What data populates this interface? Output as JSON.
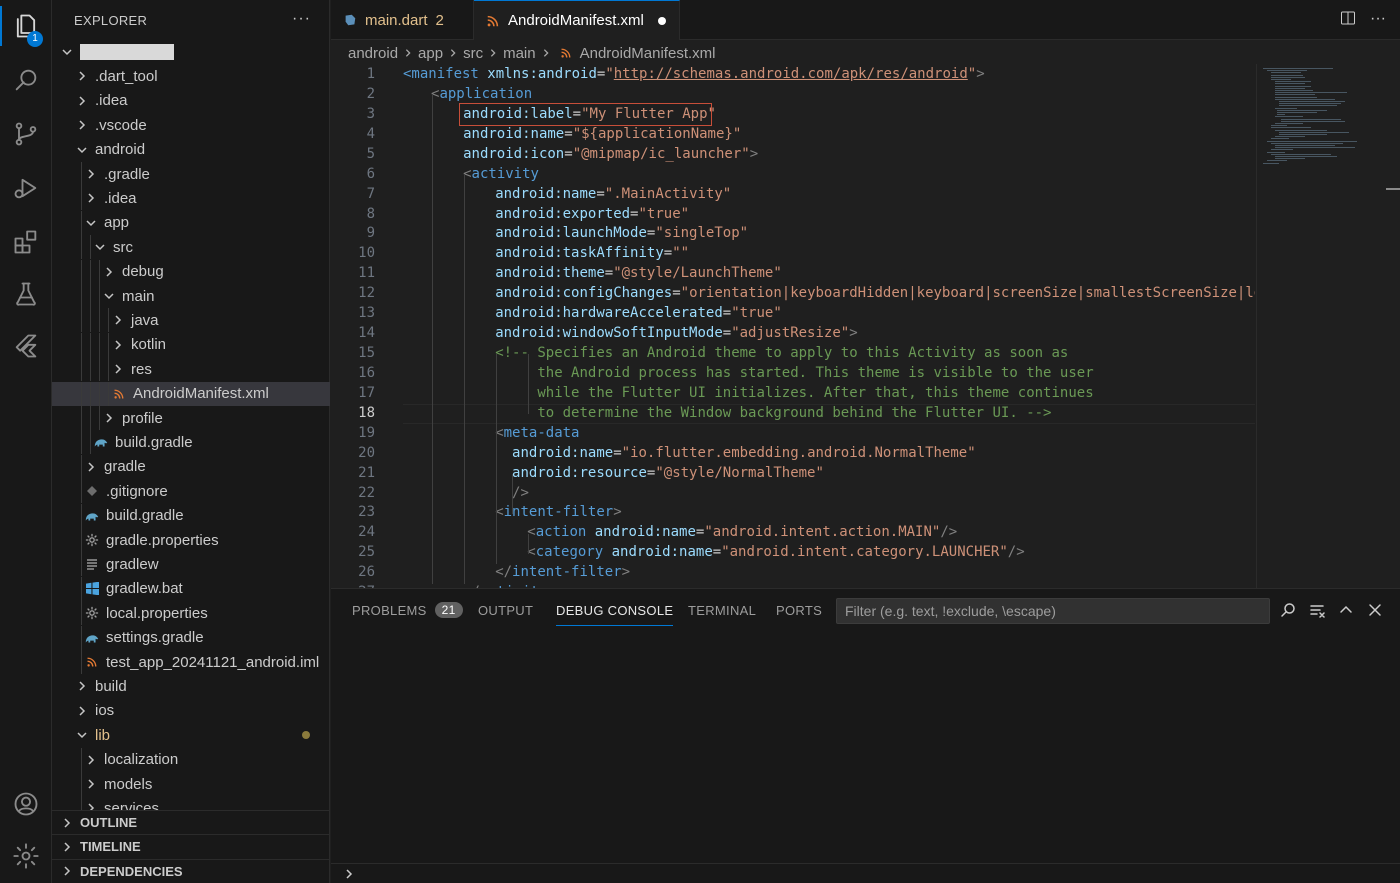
{
  "activity": {
    "explorer_badge": "1"
  },
  "sidebar": {
    "title": "EXPLORER",
    "more": "···",
    "tree": [
      {
        "label": "",
        "depth": 0,
        "kind": "folder-open",
        "redacted": true
      },
      {
        "label": ".dart_tool",
        "depth": 1,
        "kind": "folder"
      },
      {
        "label": ".idea",
        "depth": 1,
        "kind": "folder"
      },
      {
        "label": ".vscode",
        "depth": 1,
        "kind": "folder"
      },
      {
        "label": "android",
        "depth": 1,
        "kind": "folder-open"
      },
      {
        "label": ".gradle",
        "depth": 2,
        "kind": "folder"
      },
      {
        "label": ".idea",
        "depth": 2,
        "kind": "folder"
      },
      {
        "label": "app",
        "depth": 2,
        "kind": "folder-open"
      },
      {
        "label": "src",
        "depth": 3,
        "kind": "folder-open"
      },
      {
        "label": "debug",
        "depth": 4,
        "kind": "folder"
      },
      {
        "label": "main",
        "depth": 4,
        "kind": "folder-open"
      },
      {
        "label": "java",
        "depth": 5,
        "kind": "folder"
      },
      {
        "label": "kotlin",
        "depth": 5,
        "kind": "folder"
      },
      {
        "label": "res",
        "depth": 5,
        "kind": "folder"
      },
      {
        "label": "AndroidManifest.xml",
        "depth": 5,
        "kind": "file",
        "icon": "rss",
        "selected": true
      },
      {
        "label": "profile",
        "depth": 4,
        "kind": "folder"
      },
      {
        "label": "build.gradle",
        "depth": 3,
        "kind": "file",
        "icon": "gradle"
      },
      {
        "label": "gradle",
        "depth": 2,
        "kind": "folder"
      },
      {
        "label": ".gitignore",
        "depth": 2,
        "kind": "file",
        "icon": "git"
      },
      {
        "label": "build.gradle",
        "depth": 2,
        "kind": "file",
        "icon": "gradle"
      },
      {
        "label": "gradle.properties",
        "depth": 2,
        "kind": "file",
        "icon": "gear"
      },
      {
        "label": "gradlew",
        "depth": 2,
        "kind": "file",
        "icon": "lines"
      },
      {
        "label": "gradlew.bat",
        "depth": 2,
        "kind": "file",
        "icon": "windows"
      },
      {
        "label": "local.properties",
        "depth": 2,
        "kind": "file",
        "icon": "gear"
      },
      {
        "label": "settings.gradle",
        "depth": 2,
        "kind": "file",
        "icon": "gradle"
      },
      {
        "label": "test_app_20241121_android.iml",
        "depth": 2,
        "kind": "file",
        "icon": "rss"
      },
      {
        "label": "build",
        "depth": 1,
        "kind": "folder"
      },
      {
        "label": "ios",
        "depth": 1,
        "kind": "folder"
      },
      {
        "label": "lib",
        "depth": 1,
        "kind": "folder-open",
        "modified": true
      },
      {
        "label": "localization",
        "depth": 2,
        "kind": "folder"
      },
      {
        "label": "models",
        "depth": 2,
        "kind": "folder"
      },
      {
        "label": "services",
        "depth": 2,
        "kind": "folder"
      }
    ],
    "sections": [
      "OUTLINE",
      "TIMELINE",
      "DEPENDENCIES"
    ]
  },
  "tabs": [
    {
      "label": "main.dart",
      "suffix": "2",
      "icon": "dart",
      "active": false
    },
    {
      "label": "AndroidManifest.xml",
      "icon": "rss",
      "active": true,
      "dirty": true
    }
  ],
  "breadcrumb": [
    "android",
    "app",
    "src",
    "main",
    "AndroidManifest.xml"
  ],
  "editor": {
    "current_line": 18,
    "lines": [
      {
        "n": 1,
        "i": 0,
        "t": [
          [
            "tag",
            "<manifest"
          ],
          [
            "plain",
            " "
          ],
          [
            "attr",
            "xmlns:android"
          ],
          [
            "plain",
            "="
          ],
          [
            "str",
            "\""
          ],
          [
            "url",
            "http://schemas.android.com/apk/res/android"
          ],
          [
            "str",
            "\""
          ],
          [
            "punct",
            ">"
          ]
        ]
      },
      {
        "n": 2,
        "i": 1,
        "t": [
          [
            "punct",
            "<"
          ],
          [
            "tag",
            "application"
          ]
        ]
      },
      {
        "n": 3,
        "i": 2,
        "t": [
          [
            "attr",
            "android:label"
          ],
          [
            "plain",
            "="
          ],
          [
            "str",
            "\"My Flutter App\""
          ]
        ]
      },
      {
        "n": 4,
        "i": 2,
        "t": [
          [
            "attr",
            "android:name"
          ],
          [
            "plain",
            "="
          ],
          [
            "str",
            "\"${applicationName}\""
          ]
        ]
      },
      {
        "n": 5,
        "i": 2,
        "t": [
          [
            "attr",
            "android:icon"
          ],
          [
            "plain",
            "="
          ],
          [
            "str",
            "\"@mipmap/ic_launcher\""
          ],
          [
            "punct",
            ">"
          ]
        ]
      },
      {
        "n": 6,
        "i": 2,
        "t": [
          [
            "punct",
            "<"
          ],
          [
            "tag",
            "activity"
          ]
        ]
      },
      {
        "n": 7,
        "i": 3,
        "t": [
          [
            "attr",
            "android:name"
          ],
          [
            "plain",
            "="
          ],
          [
            "str",
            "\".MainActivity\""
          ]
        ]
      },
      {
        "n": 8,
        "i": 3,
        "t": [
          [
            "attr",
            "android:exported"
          ],
          [
            "plain",
            "="
          ],
          [
            "str",
            "\"true\""
          ]
        ]
      },
      {
        "n": 9,
        "i": 3,
        "t": [
          [
            "attr",
            "android:launchMode"
          ],
          [
            "plain",
            "="
          ],
          [
            "str",
            "\"singleTop\""
          ]
        ]
      },
      {
        "n": 10,
        "i": 3,
        "t": [
          [
            "attr",
            "android:taskAffinity"
          ],
          [
            "plain",
            "="
          ],
          [
            "str",
            "\"\""
          ]
        ]
      },
      {
        "n": 11,
        "i": 3,
        "t": [
          [
            "attr",
            "android:theme"
          ],
          [
            "plain",
            "="
          ],
          [
            "str",
            "\"@style/LaunchTheme\""
          ]
        ]
      },
      {
        "n": 12,
        "i": 3,
        "t": [
          [
            "attr",
            "android:configChanges"
          ],
          [
            "plain",
            "="
          ],
          [
            "str",
            "\"orientation|keyboardHidden|keyboard|screenSize|smallestScreenSize|locale"
          ]
        ]
      },
      {
        "n": 13,
        "i": 3,
        "t": [
          [
            "attr",
            "android:hardwareAccelerated"
          ],
          [
            "plain",
            "="
          ],
          [
            "str",
            "\"true\""
          ]
        ]
      },
      {
        "n": 14,
        "i": 3,
        "t": [
          [
            "attr",
            "android:windowSoftInputMode"
          ],
          [
            "plain",
            "="
          ],
          [
            "str",
            "\"adjustResize\""
          ],
          [
            "punct",
            ">"
          ]
        ]
      },
      {
        "n": 15,
        "i": 3,
        "t": [
          [
            "com",
            "<!-- Specifies an Android theme to apply to this Activity as soon as"
          ]
        ]
      },
      {
        "n": 16,
        "i": 3,
        "t": [
          [
            "com",
            "     the Android process has started. This theme is visible to the user"
          ]
        ]
      },
      {
        "n": 17,
        "i": 3,
        "t": [
          [
            "com",
            "     while the Flutter UI initializes. After that, this theme continues"
          ]
        ]
      },
      {
        "n": 18,
        "i": 3,
        "t": [
          [
            "com",
            "     to determine the Window background behind the Flutter UI. -->"
          ]
        ]
      },
      {
        "n": 19,
        "i": 3,
        "t": [
          [
            "punct",
            "<"
          ],
          [
            "tag",
            "meta-data"
          ]
        ]
      },
      {
        "n": 20,
        "i": 3,
        "t": [
          [
            "plain",
            "  "
          ],
          [
            "attr",
            "android:name"
          ],
          [
            "plain",
            "="
          ],
          [
            "str",
            "\"io.flutter.embedding.android.NormalTheme\""
          ]
        ]
      },
      {
        "n": 21,
        "i": 3,
        "t": [
          [
            "plain",
            "  "
          ],
          [
            "attr",
            "android:resource"
          ],
          [
            "plain",
            "="
          ],
          [
            "str",
            "\"@style/NormalTheme\""
          ]
        ]
      },
      {
        "n": 22,
        "i": 3,
        "t": [
          [
            "plain",
            "  "
          ],
          [
            "punct",
            "/>"
          ]
        ]
      },
      {
        "n": 23,
        "i": 3,
        "t": [
          [
            "punct",
            "<"
          ],
          [
            "tag",
            "intent-filter"
          ],
          [
            "punct",
            ">"
          ]
        ]
      },
      {
        "n": 24,
        "i": 4,
        "t": [
          [
            "punct",
            "<"
          ],
          [
            "tag",
            "action"
          ],
          [
            "plain",
            " "
          ],
          [
            "attr",
            "android:name"
          ],
          [
            "plain",
            "="
          ],
          [
            "str",
            "\"android.intent.action.MAIN\""
          ],
          [
            "punct",
            "/>"
          ]
        ]
      },
      {
        "n": 25,
        "i": 4,
        "t": [
          [
            "punct",
            "<"
          ],
          [
            "tag",
            "category"
          ],
          [
            "plain",
            " "
          ],
          [
            "attr",
            "android:name"
          ],
          [
            "plain",
            "="
          ],
          [
            "str",
            "\"android.intent.category.LAUNCHER\""
          ],
          [
            "punct",
            "/>"
          ]
        ]
      },
      {
        "n": 26,
        "i": 3,
        "t": [
          [
            "punct",
            "</"
          ],
          [
            "tag",
            "intent-filter"
          ],
          [
            "punct",
            ">"
          ]
        ]
      },
      {
        "n": 27,
        "i": 2,
        "t": [
          [
            "punct",
            "</"
          ],
          [
            "tag",
            "activity"
          ],
          [
            "punct",
            ">"
          ]
        ]
      }
    ]
  },
  "panel": {
    "tabs": [
      {
        "label": "PROBLEMS",
        "badge": "21"
      },
      {
        "label": "OUTPUT"
      },
      {
        "label": "DEBUG CONSOLE",
        "active": true
      },
      {
        "label": "TERMINAL"
      },
      {
        "label": "PORTS"
      }
    ],
    "filter_placeholder": "Filter (e.g. text, !exclude, \\escape)"
  },
  "colors": {
    "accent": "#0078d4",
    "tag": "#569cd6",
    "attribute": "#9cdcfe",
    "string": "#ce9178",
    "comment": "#6a9955",
    "highlight_box": "#c74e39"
  }
}
